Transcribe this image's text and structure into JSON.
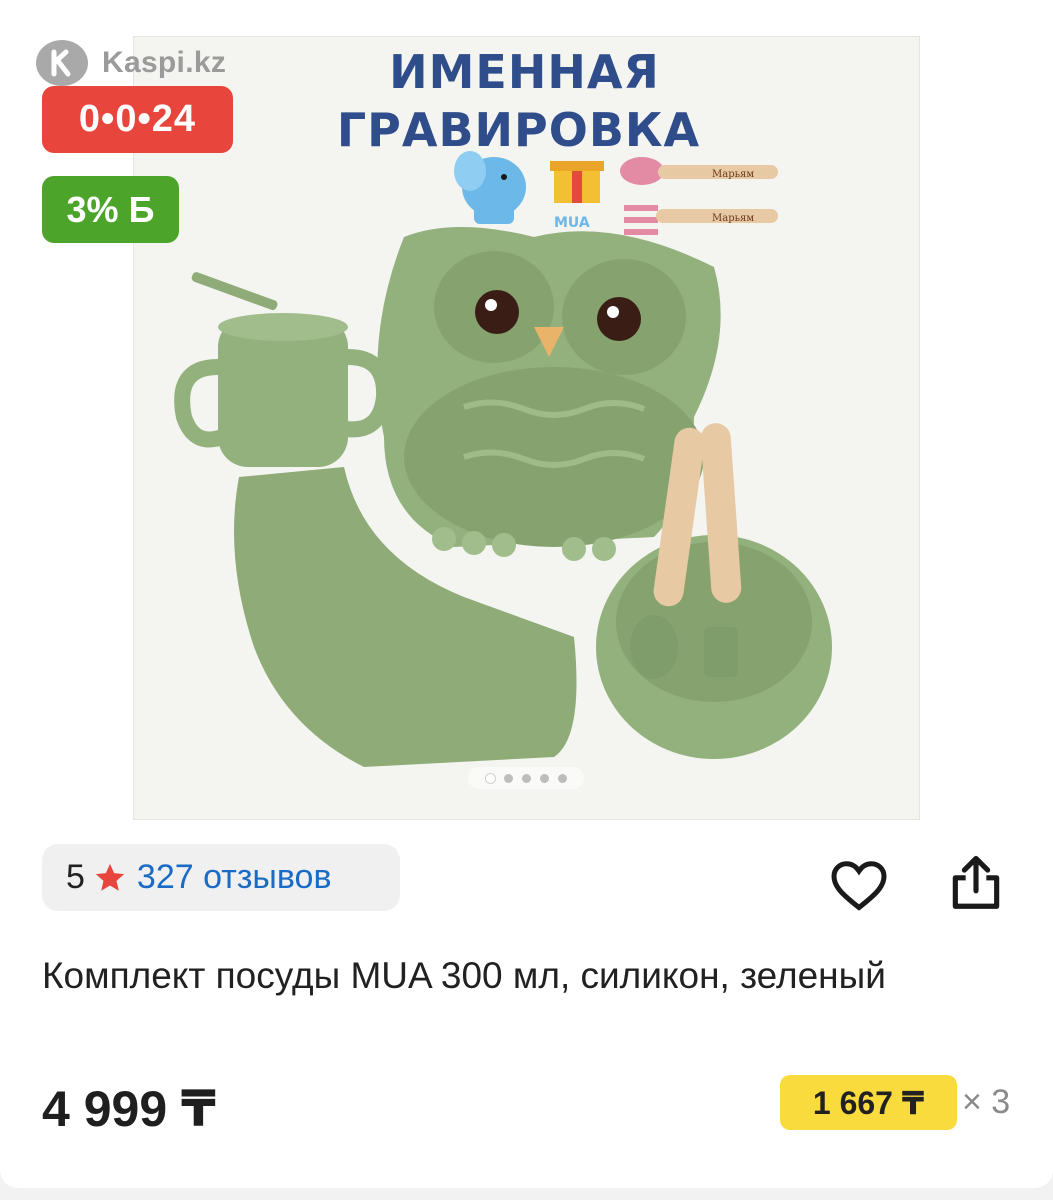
{
  "header": {
    "logo_text": "Kaspi.kz",
    "logo_icon": "kaspi-logo-icon"
  },
  "badges": {
    "installment": "0•0•24",
    "bonus": "3% Б"
  },
  "gallery": {
    "promo_line1": "ИМЕННАЯ",
    "promo_line2": "ГРАВИРОВКА",
    "brand_mark": "MUA",
    "engraving_name": "Марьям",
    "image_count": 5,
    "active_index": 0
  },
  "product": {
    "rating_score": "5",
    "reviews_label": "327 отзывов",
    "title": "Комплект посуды MUA 300 мл, силикон, зеленый",
    "price": "4 999 ₸",
    "monthly_payment": "1 667 ₸",
    "months": "× 3"
  },
  "colors": {
    "installment_badge": "#e8453c",
    "bonus_badge": "#4ca52a",
    "monthly_badge": "#fadb3d",
    "reviews_link": "#1a6bc6",
    "rating_star": "#e8453c"
  },
  "icons": {
    "favorite": "heart-icon",
    "share": "share-icon",
    "star": "star-icon"
  }
}
